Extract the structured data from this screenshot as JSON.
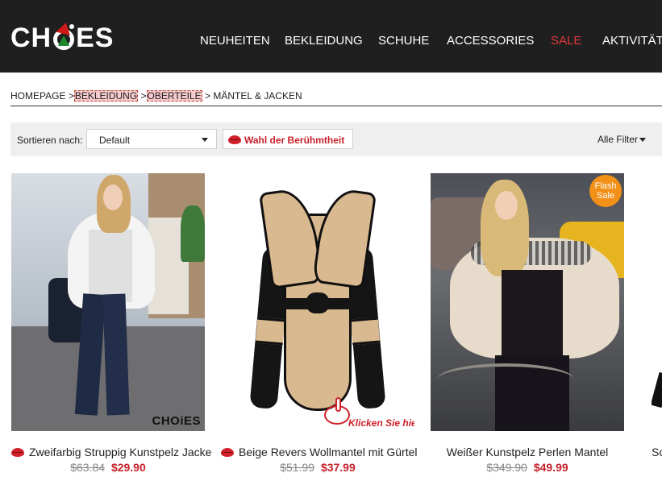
{
  "header": {
    "logo_text_left": "CH",
    "logo_text_right": "ES",
    "nav": [
      {
        "label": "NEUHEITEN"
      },
      {
        "label": "BEKLEIDUNG"
      },
      {
        "label": "SCHUHE"
      },
      {
        "label": "ACCESSORIES"
      },
      {
        "label": "SALE",
        "highlight": "#e0383e"
      },
      {
        "label": "AKTIVITÄT"
      }
    ]
  },
  "breadcrumb": {
    "home": "HOMEPAGE",
    "sep": ">",
    "level1": "BEKLEIDUNG",
    "level2": "OBERTEILE",
    "current": "MÄNTEL & JACKEN"
  },
  "toolbar": {
    "sort_label": "Sortieren nach:",
    "sort_value": "Default",
    "celebrity_label": "Wahl der Berühmtheit",
    "filter_label": "Alle Filter"
  },
  "products": [
    {
      "title": "Zweifarbig Struppig Kunstpelz Jacke",
      "old_price": "$63.84",
      "new_price": "$29.90",
      "celebrity": true,
      "watermark": "CHOiES"
    },
    {
      "title": "Beige Revers Wollmantel mit Gürtel",
      "old_price": "$51.99",
      "new_price": "$37.99",
      "celebrity": true,
      "overlay_text": "Klicken Sie hier"
    },
    {
      "title": "Weißer Kunstpelz Perlen Mantel",
      "old_price": "$349.90",
      "new_price": "$49.99",
      "celebrity": false,
      "badge": "Flash Sale"
    }
  ],
  "partial_product_title": "Sc",
  "colors": {
    "header_bg": "#1f1f1f",
    "accent_red": "#c8202a",
    "badge_orange": "#f29018"
  }
}
